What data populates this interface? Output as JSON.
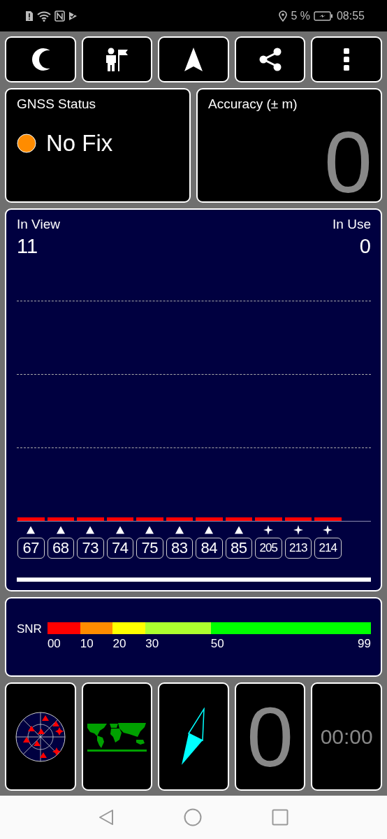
{
  "status_bar": {
    "battery": "5 %",
    "time": "08:55"
  },
  "toolbar": [
    {
      "kind": "night"
    },
    {
      "kind": "person-flag"
    },
    {
      "kind": "navigate"
    },
    {
      "kind": "share"
    },
    {
      "kind": "menu"
    }
  ],
  "gnss_status": {
    "title": "GNSS Status",
    "status": "No Fix"
  },
  "accuracy": {
    "title": "Accuracy (± m)",
    "value": "0"
  },
  "satellites": {
    "in_view_label": "In View",
    "in_view": "11",
    "in_use_label": "In Use",
    "in_use": "0",
    "items": [
      {
        "id": "67",
        "kind": "triangle"
      },
      {
        "id": "68",
        "kind": "triangle"
      },
      {
        "id": "73",
        "kind": "triangle"
      },
      {
        "id": "74",
        "kind": "triangle"
      },
      {
        "id": "75",
        "kind": "triangle"
      },
      {
        "id": "83",
        "kind": "triangle"
      },
      {
        "id": "84",
        "kind": "triangle"
      },
      {
        "id": "85",
        "kind": "triangle"
      },
      {
        "id": "205",
        "kind": "star"
      },
      {
        "id": "213",
        "kind": "star"
      },
      {
        "id": "214",
        "kind": "star"
      }
    ]
  },
  "snr": {
    "label": "SNR",
    "segments": [
      {
        "label": "00",
        "color": "#ff0000"
      },
      {
        "label": "10",
        "color": "#ff8c00"
      },
      {
        "label": "20",
        "color": "#ffff00"
      },
      {
        "label": "30",
        "color": "#adff2f"
      },
      {
        "label": "50",
        "color": "#00ff00"
      }
    ],
    "end_label": "99"
  },
  "tiles": [
    {
      "kind": "sky-plot"
    },
    {
      "kind": "world-map"
    },
    {
      "kind": "compass"
    },
    {
      "kind": "speed",
      "value": "0"
    },
    {
      "kind": "timer",
      "value": "00:00"
    }
  ]
}
